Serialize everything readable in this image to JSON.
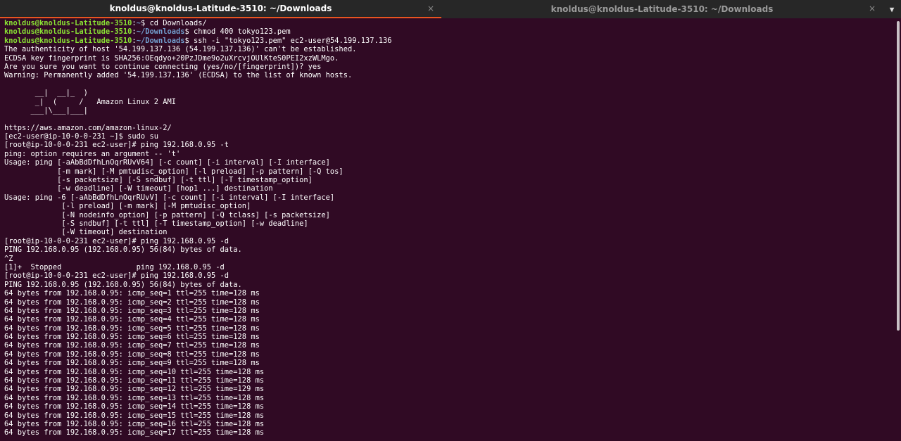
{
  "tabs": [
    {
      "title": "knoldus@knoldus-Latitude-3510: ~/Downloads",
      "close": "×"
    },
    {
      "title": "knoldus@knoldus-Latitude-3510: ~/Downloads",
      "close": "×"
    }
  ],
  "menu_icon": "▼",
  "colors": {
    "background": "#300a24",
    "user": "#8ae234",
    "path": "#729fcf",
    "active_tab_underline": "#e95420"
  },
  "terminal": {
    "lines": [
      {
        "user": "knoldus@knoldus-Latitude-3510",
        "path": "~",
        "text": "$ cd Downloads/"
      },
      {
        "user": "knoldus@knoldus-Latitude-3510",
        "path": "~/Downloads",
        "text": "$ chmod 400 tokyo123.pem"
      },
      {
        "user": "knoldus@knoldus-Latitude-3510",
        "path": "~/Downloads",
        "text": "$ ssh -i \"tokyo123.pem\" ec2-user@54.199.137.136"
      },
      {
        "text": "The authenticity of host '54.199.137.136 (54.199.137.136)' can't be established."
      },
      {
        "text": "ECDSA key fingerprint is SHA256:OEqdyo+20PzJDme9o2uXrcvjOUlKteS0PEI2xzWLMgo."
      },
      {
        "text": "Are you sure you want to continue connecting (yes/no/[fingerprint])? yes"
      },
      {
        "text": "Warning: Permanently added '54.199.137.136' (ECDSA) to the list of known hosts."
      },
      {
        "text": ""
      },
      {
        "text": "       __|  __|_  )"
      },
      {
        "text": "       _|  (     /   Amazon Linux 2 AMI"
      },
      {
        "text": "      ___|\\___|___|"
      },
      {
        "text": ""
      },
      {
        "text": "https://aws.amazon.com/amazon-linux-2/"
      },
      {
        "text": "[ec2-user@ip-10-0-0-231 ~]$ sudo su"
      },
      {
        "text": "[root@ip-10-0-0-231 ec2-user]# ping 192.168.0.95 -t"
      },
      {
        "text": "ping: option requires an argument -- 't'"
      },
      {
        "text": "Usage: ping [-aAbBdDfhLnOqrRUvV64] [-c count] [-i interval] [-I interface]"
      },
      {
        "text": "            [-m mark] [-M pmtudisc_option] [-l preload] [-p pattern] [-Q tos]"
      },
      {
        "text": "            [-s packetsize] [-S sndbuf] [-t ttl] [-T timestamp_option]"
      },
      {
        "text": "            [-w deadline] [-W timeout] [hop1 ...] destination"
      },
      {
        "text": "Usage: ping -6 [-aAbBdDfhLnOqrRUvV] [-c count] [-i interval] [-I interface]"
      },
      {
        "text": "             [-l preload] [-m mark] [-M pmtudisc_option]"
      },
      {
        "text": "             [-N nodeinfo_option] [-p pattern] [-Q tclass] [-s packetsize]"
      },
      {
        "text": "             [-S sndbuf] [-t ttl] [-T timestamp_option] [-w deadline]"
      },
      {
        "text": "             [-W timeout] destination"
      },
      {
        "text": "[root@ip-10-0-0-231 ec2-user]# ping 192.168.0.95 -d"
      },
      {
        "text": "PING 192.168.0.95 (192.168.0.95) 56(84) bytes of data."
      },
      {
        "text": "^Z"
      },
      {
        "text": "[1]+  Stopped                 ping 192.168.0.95 -d"
      },
      {
        "text": "[root@ip-10-0-0-231 ec2-user]# ping 192.168.0.95 -d"
      },
      {
        "text": "PING 192.168.0.95 (192.168.0.95) 56(84) bytes of data."
      },
      {
        "text": "64 bytes from 192.168.0.95: icmp_seq=1 ttl=255 time=128 ms"
      },
      {
        "text": "64 bytes from 192.168.0.95: icmp_seq=2 ttl=255 time=128 ms"
      },
      {
        "text": "64 bytes from 192.168.0.95: icmp_seq=3 ttl=255 time=128 ms"
      },
      {
        "text": "64 bytes from 192.168.0.95: icmp_seq=4 ttl=255 time=128 ms"
      },
      {
        "text": "64 bytes from 192.168.0.95: icmp_seq=5 ttl=255 time=128 ms"
      },
      {
        "text": "64 bytes from 192.168.0.95: icmp_seq=6 ttl=255 time=128 ms"
      },
      {
        "text": "64 bytes from 192.168.0.95: icmp_seq=7 ttl=255 time=128 ms"
      },
      {
        "text": "64 bytes from 192.168.0.95: icmp_seq=8 ttl=255 time=128 ms"
      },
      {
        "text": "64 bytes from 192.168.0.95: icmp_seq=9 ttl=255 time=128 ms"
      },
      {
        "text": "64 bytes from 192.168.0.95: icmp_seq=10 ttl=255 time=128 ms"
      },
      {
        "text": "64 bytes from 192.168.0.95: icmp_seq=11 ttl=255 time=128 ms"
      },
      {
        "text": "64 bytes from 192.168.0.95: icmp_seq=12 ttl=255 time=129 ms"
      },
      {
        "text": "64 bytes from 192.168.0.95: icmp_seq=13 ttl=255 time=128 ms"
      },
      {
        "text": "64 bytes from 192.168.0.95: icmp_seq=14 ttl=255 time=128 ms"
      },
      {
        "text": "64 bytes from 192.168.0.95: icmp_seq=15 ttl=255 time=128 ms"
      },
      {
        "text": "64 bytes from 192.168.0.95: icmp_seq=16 ttl=255 time=128 ms"
      },
      {
        "text": "64 bytes from 192.168.0.95: icmp_seq=17 ttl=255 time=128 ms"
      }
    ]
  }
}
